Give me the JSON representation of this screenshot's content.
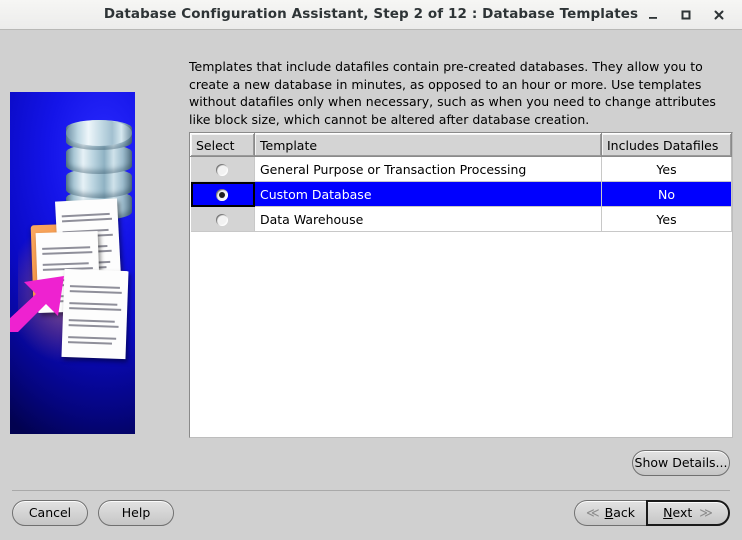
{
  "window": {
    "title": "Database Configuration Assistant, Step 2 of 12 : Database Templates",
    "minimize_label": "minimize-icon",
    "maximize_label": "maximize-icon",
    "close_label": "close-icon"
  },
  "description": "Templates that include datafiles contain pre-created databases. They allow you to create a new database in minutes, as opposed to an hour or more. Use templates without datafiles only when necessary, such as when you need to change attributes like block size, which cannot be altered after database creation.",
  "table": {
    "columns": [
      "Select",
      "Template",
      "Includes Datafiles"
    ],
    "rows": [
      {
        "selected": false,
        "template": "General Purpose or Transaction Processing",
        "datafiles": "Yes"
      },
      {
        "selected": true,
        "template": "Custom Database",
        "datafiles": "No"
      },
      {
        "selected": false,
        "template": "Data Warehouse",
        "datafiles": "Yes"
      }
    ]
  },
  "buttons": {
    "show_details": "Show Details...",
    "cancel": "Cancel",
    "help": "Help",
    "back_mnemonic": "B",
    "back_rest": "ack",
    "next_mnemonic": "N",
    "next_rest": "ext",
    "back_chevron": "≪",
    "next_chevron": "≫"
  },
  "colors": {
    "selection_blue": "#0000ff",
    "window_bg": "#d0d0d0",
    "splash_blue": "#0a0ac4",
    "arrow_magenta": "#ef22d2",
    "folder_orange": "#ef7f29"
  }
}
